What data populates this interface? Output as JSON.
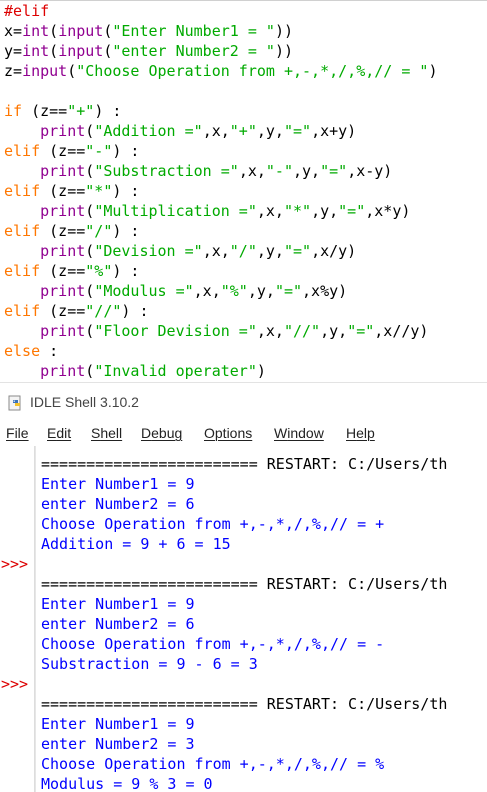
{
  "editor": {
    "lines": [
      [
        {
          "t": "#elif",
          "c": "cm"
        }
      ],
      [
        {
          "t": "x=",
          "c": "pl"
        },
        {
          "t": "int",
          "c": "bi"
        },
        {
          "t": "(",
          "c": "pl"
        },
        {
          "t": "input",
          "c": "bi"
        },
        {
          "t": "(",
          "c": "pl"
        },
        {
          "t": "\"Enter Number1 = \"",
          "c": "st"
        },
        {
          "t": "))",
          "c": "pl"
        }
      ],
      [
        {
          "t": "y=",
          "c": "pl"
        },
        {
          "t": "int",
          "c": "bi"
        },
        {
          "t": "(",
          "c": "pl"
        },
        {
          "t": "input",
          "c": "bi"
        },
        {
          "t": "(",
          "c": "pl"
        },
        {
          "t": "\"enter Number2 = \"",
          "c": "st"
        },
        {
          "t": "))",
          "c": "pl"
        }
      ],
      [
        {
          "t": "z=",
          "c": "pl"
        },
        {
          "t": "input",
          "c": "bi"
        },
        {
          "t": "(",
          "c": "pl"
        },
        {
          "t": "\"Choose Operation from +,-,*,/,%,// = \"",
          "c": "st"
        },
        {
          "t": ")",
          "c": "pl"
        }
      ],
      [],
      [
        {
          "t": "if",
          "c": "kw"
        },
        {
          "t": " (z==",
          "c": "pl"
        },
        {
          "t": "\"+\"",
          "c": "st"
        },
        {
          "t": ") :",
          "c": "pl"
        }
      ],
      [
        {
          "t": "    ",
          "c": "pl"
        },
        {
          "t": "print",
          "c": "bi"
        },
        {
          "t": "(",
          "c": "pl"
        },
        {
          "t": "\"Addition =\"",
          "c": "st"
        },
        {
          "t": ",x,",
          "c": "pl"
        },
        {
          "t": "\"+\"",
          "c": "st"
        },
        {
          "t": ",y,",
          "c": "pl"
        },
        {
          "t": "\"=\"",
          "c": "st"
        },
        {
          "t": ",x+y)",
          "c": "pl"
        }
      ],
      [
        {
          "t": "elif",
          "c": "kw"
        },
        {
          "t": " (z==",
          "c": "pl"
        },
        {
          "t": "\"-\"",
          "c": "st"
        },
        {
          "t": ") :",
          "c": "pl"
        }
      ],
      [
        {
          "t": "    ",
          "c": "pl"
        },
        {
          "t": "print",
          "c": "bi"
        },
        {
          "t": "(",
          "c": "pl"
        },
        {
          "t": "\"Substraction =\"",
          "c": "st"
        },
        {
          "t": ",x,",
          "c": "pl"
        },
        {
          "t": "\"-\"",
          "c": "st"
        },
        {
          "t": ",y,",
          "c": "pl"
        },
        {
          "t": "\"=\"",
          "c": "st"
        },
        {
          "t": ",x-y)",
          "c": "pl"
        }
      ],
      [
        {
          "t": "elif",
          "c": "kw"
        },
        {
          "t": " (z==",
          "c": "pl"
        },
        {
          "t": "\"*\"",
          "c": "st"
        },
        {
          "t": ") :",
          "c": "pl"
        }
      ],
      [
        {
          "t": "    ",
          "c": "pl"
        },
        {
          "t": "print",
          "c": "bi"
        },
        {
          "t": "(",
          "c": "pl"
        },
        {
          "t": "\"Multiplication =\"",
          "c": "st"
        },
        {
          "t": ",x,",
          "c": "pl"
        },
        {
          "t": "\"*\"",
          "c": "st"
        },
        {
          "t": ",y,",
          "c": "pl"
        },
        {
          "t": "\"=\"",
          "c": "st"
        },
        {
          "t": ",x*y)",
          "c": "pl"
        }
      ],
      [
        {
          "t": "elif",
          "c": "kw"
        },
        {
          "t": " (z==",
          "c": "pl"
        },
        {
          "t": "\"/\"",
          "c": "st"
        },
        {
          "t": ") :",
          "c": "pl"
        }
      ],
      [
        {
          "t": "    ",
          "c": "pl"
        },
        {
          "t": "print",
          "c": "bi"
        },
        {
          "t": "(",
          "c": "pl"
        },
        {
          "t": "\"Devision =\"",
          "c": "st"
        },
        {
          "t": ",x,",
          "c": "pl"
        },
        {
          "t": "\"/\"",
          "c": "st"
        },
        {
          "t": ",y,",
          "c": "pl"
        },
        {
          "t": "\"=\"",
          "c": "st"
        },
        {
          "t": ",x/y)",
          "c": "pl"
        }
      ],
      [
        {
          "t": "elif",
          "c": "kw"
        },
        {
          "t": " (z==",
          "c": "pl"
        },
        {
          "t": "\"%\"",
          "c": "st"
        },
        {
          "t": ") :",
          "c": "pl"
        }
      ],
      [
        {
          "t": "    ",
          "c": "pl"
        },
        {
          "t": "print",
          "c": "bi"
        },
        {
          "t": "(",
          "c": "pl"
        },
        {
          "t": "\"Modulus =\"",
          "c": "st"
        },
        {
          "t": ",x,",
          "c": "pl"
        },
        {
          "t": "\"%\"",
          "c": "st"
        },
        {
          "t": ",y,",
          "c": "pl"
        },
        {
          "t": "\"=\"",
          "c": "st"
        },
        {
          "t": ",x%y)",
          "c": "pl"
        }
      ],
      [
        {
          "t": "elif",
          "c": "kw"
        },
        {
          "t": " (z==",
          "c": "pl"
        },
        {
          "t": "\"//\"",
          "c": "st"
        },
        {
          "t": ") :",
          "c": "pl"
        }
      ],
      [
        {
          "t": "    ",
          "c": "pl"
        },
        {
          "t": "print",
          "c": "bi"
        },
        {
          "t": "(",
          "c": "pl"
        },
        {
          "t": "\"Floor Devision =\"",
          "c": "st"
        },
        {
          "t": ",x,",
          "c": "pl"
        },
        {
          "t": "\"//\"",
          "c": "st"
        },
        {
          "t": ",y,",
          "c": "pl"
        },
        {
          "t": "\"=\"",
          "c": "st"
        },
        {
          "t": ",x//y)",
          "c": "pl"
        }
      ],
      [
        {
          "t": "else",
          "c": "kw"
        },
        {
          "t": " :",
          "c": "pl"
        }
      ],
      [
        {
          "t": "    ",
          "c": "pl"
        },
        {
          "t": "print",
          "c": "bi"
        },
        {
          "t": "(",
          "c": "pl"
        },
        {
          "t": "\"Invalid operater\"",
          "c": "st"
        },
        {
          "t": ")",
          "c": "pl"
        }
      ]
    ]
  },
  "window": {
    "title": "IDLE Shell 3.10.2",
    "icon": "python-idle-icon"
  },
  "menu": [
    "File",
    "Edit",
    "Shell",
    "Debug",
    "Options",
    "Window",
    "Help"
  ],
  "shell": {
    "prompt": ">>>",
    "lines": [
      {
        "t": "======================== RESTART: C:/Users/th",
        "c": "black"
      },
      {
        "t": "Enter Number1 = 9",
        "c": "blue"
      },
      {
        "t": "enter Number2 = 6",
        "c": "blue"
      },
      {
        "t": "Choose Operation from +,-,*,/,%,// = +",
        "c": "blue"
      },
      {
        "t": "Addition = 9 + 6 = 15",
        "c": "blue"
      },
      {
        "t": "",
        "c": "black"
      },
      {
        "t": "======================== RESTART: C:/Users/th",
        "c": "black"
      },
      {
        "t": "Enter Number1 = 9",
        "c": "blue"
      },
      {
        "t": "enter Number2 = 6",
        "c": "blue"
      },
      {
        "t": "Choose Operation from +,-,*,/,%,// = -",
        "c": "blue"
      },
      {
        "t": "Substraction = 9 - 6 = 3",
        "c": "blue"
      },
      {
        "t": "",
        "c": "black"
      },
      {
        "t": "======================== RESTART: C:/Users/th",
        "c": "black"
      },
      {
        "t": "Enter Number1 = 9",
        "c": "blue"
      },
      {
        "t": "enter Number2 = 3",
        "c": "blue"
      },
      {
        "t": "Choose Operation from +,-,*,/,%,// = %",
        "c": "blue"
      },
      {
        "t": "Modulus = 9 % 3 = 0",
        "c": "blue"
      }
    ],
    "prompt_rows": [
      5,
      11
    ]
  },
  "colors": {
    "keyword": "#ff7700",
    "builtin": "#900090",
    "string": "#00aa00",
    "comment": "#dd0000",
    "shell_output": "#0000ff",
    "prompt": "#dd0000"
  }
}
